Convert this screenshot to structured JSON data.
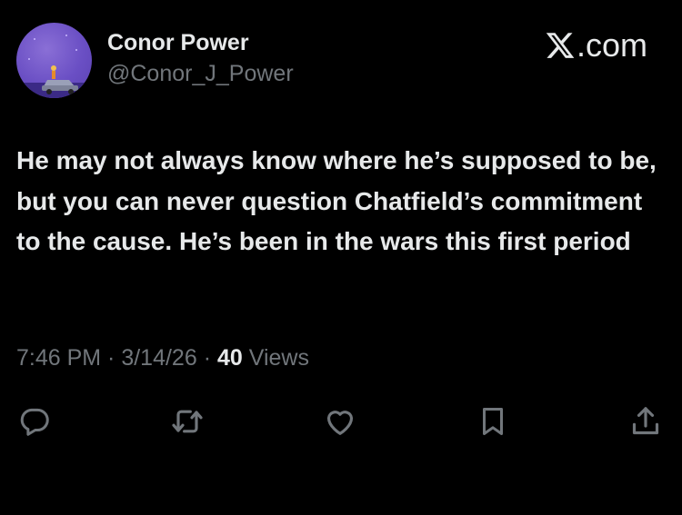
{
  "author": {
    "display_name": "Conor Power",
    "handle": "@Conor_J_Power",
    "avatar_icon": "avatar-image"
  },
  "brand": {
    "logo_icon": "x-logo-icon",
    "domain": ".com"
  },
  "tweet": {
    "text": "He may not always know where he’s supposed to be, but you can never question Chatfield’s commitment to the cause. He’s been in the wars this first period"
  },
  "meta": {
    "time": "7:46 PM",
    "separator1": " · ",
    "date": "3/14/26",
    "separator2": " · ",
    "views_count": "40",
    "views_label": " Views"
  },
  "actions": [
    {
      "icon": "reply-icon"
    },
    {
      "icon": "retweet-icon"
    },
    {
      "icon": "like-icon"
    },
    {
      "icon": "bookmark-icon"
    },
    {
      "icon": "share-icon"
    }
  ],
  "colors": {
    "background": "#000000",
    "primary_text": "#e7e9ea",
    "secondary_text": "#71767b",
    "avatar_bg": "#6a4fc4"
  }
}
